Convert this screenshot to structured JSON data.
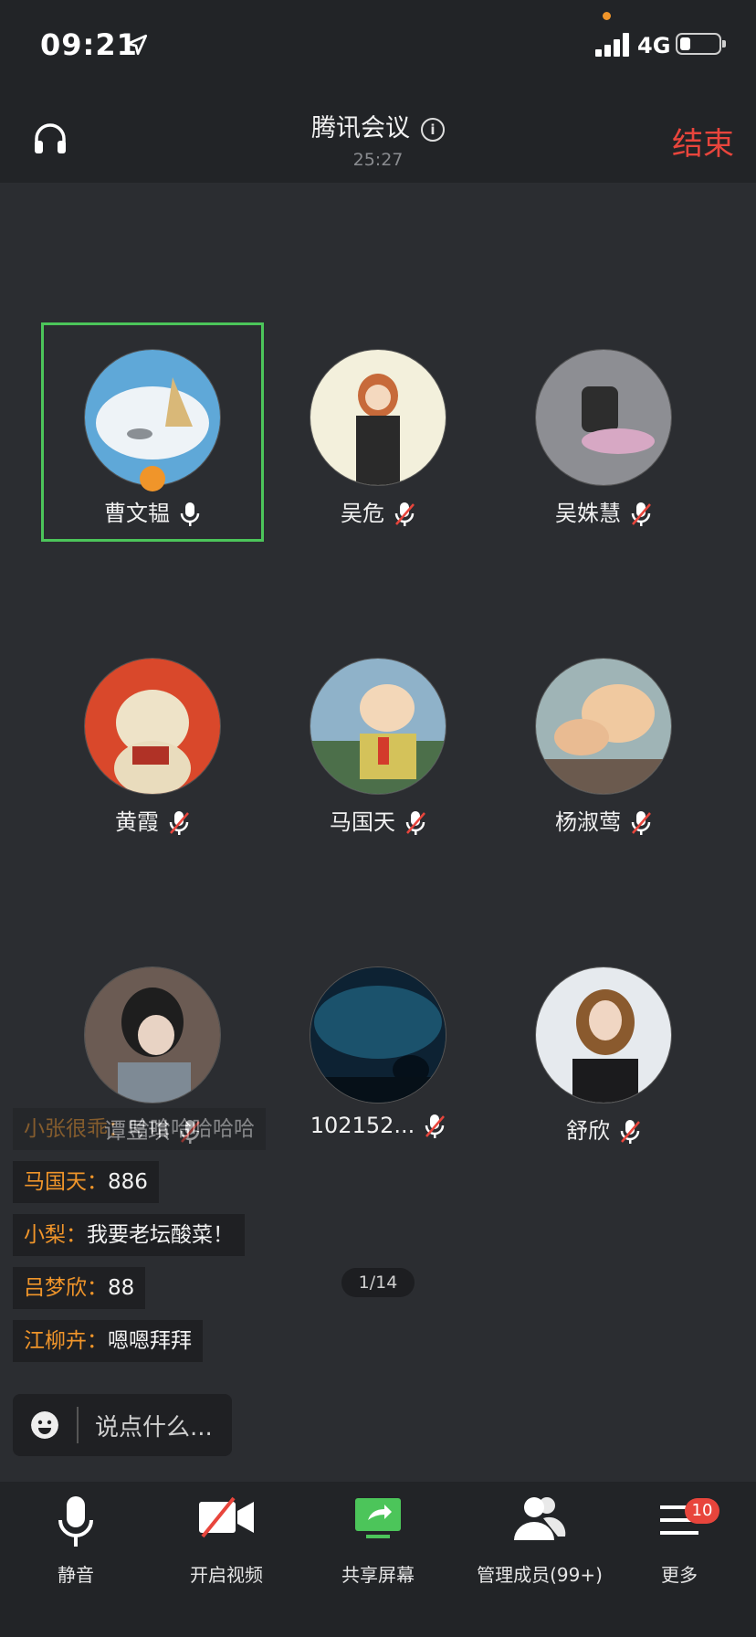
{
  "status": {
    "time": "09:21",
    "network": "4G"
  },
  "header": {
    "title": "腾讯会议",
    "duration": "25:27",
    "end_label": "结束"
  },
  "participants": [
    {
      "name": "曹文韫",
      "muted": false
    },
    {
      "name": "吴危",
      "muted": true
    },
    {
      "name": "吴姝慧",
      "muted": true
    },
    {
      "name": "黄霞",
      "muted": true
    },
    {
      "name": "马国天",
      "muted": true
    },
    {
      "name": "杨淑莺",
      "muted": true
    },
    {
      "name": "谭昱琪",
      "muted": true
    },
    {
      "name": "102152...",
      "muted": true
    },
    {
      "name": "舒欣",
      "muted": true
    }
  ],
  "chat": [
    {
      "who": "小张很乖：",
      "text": "哈哈哈哈哈哈"
    },
    {
      "who": "马国天：",
      "text": "886"
    },
    {
      "who": "小梨：",
      "text": "我要老坛酸菜！"
    },
    {
      "who": "吕梦欣：",
      "text": "88"
    },
    {
      "who": "江柳卉：",
      "text": "嗯嗯拜拜"
    }
  ],
  "page_indicator": "1/14",
  "chat_input": {
    "placeholder": "说点什么..."
  },
  "toolbar": {
    "mute": "静音",
    "video": "开启视频",
    "share": "共享屏幕",
    "members": "管理成员(99+)",
    "more": "更多",
    "more_badge": "10"
  },
  "colors": {
    "accent": "#4cc55a",
    "end": "#e8453c",
    "chat_name": "#f0952a"
  }
}
